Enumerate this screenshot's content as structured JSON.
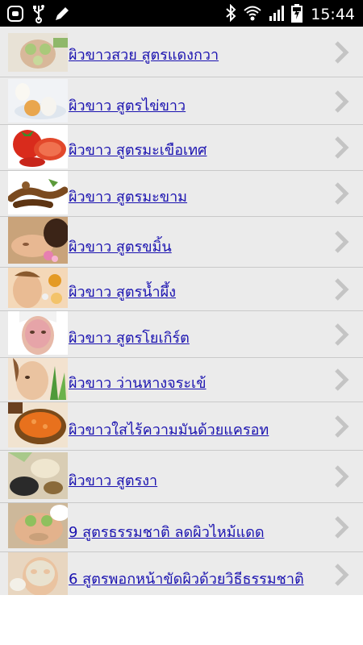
{
  "status_bar": {
    "time": "15:44",
    "left_icons": [
      "app-notification-icon",
      "usb-icon",
      "pencil-icon"
    ],
    "right_icons": [
      "bluetooth-icon",
      "wifi-icon",
      "signal-icon",
      "battery-icon"
    ]
  },
  "list": {
    "items": [
      {
        "label": "ผิวขาวสวย สูตรแดงกวา",
        "thumb": "cucumber-mask-thumbnail"
      },
      {
        "label": "ผิวขาว สูตรไข่ขาว",
        "thumb": "egg-thumbnail"
      },
      {
        "label": "ผิวขาว สูตรมะเขือเทศ",
        "thumb": "tomato-thumbnail"
      },
      {
        "label": "ผิวขาว สูตรมะขาม",
        "thumb": "tamarind-thumbnail"
      },
      {
        "label": "ผิวขาว สูตรขมิ้น",
        "thumb": "spa-face-thumbnail"
      },
      {
        "label": "ผิวขาว สูตรน้ำผึ้ง",
        "thumb": "honey-face-thumbnail"
      },
      {
        "label": "ผิวขาว สูตรโยเกิร์ต",
        "thumb": "yogurt-mask-thumbnail"
      },
      {
        "label": "ผิวขาว ว่านหางจระเข้",
        "thumb": "aloe-face-thumbnail"
      },
      {
        "label": "ผิวขาวใสไร้ความมันด้วยแครอท",
        "thumb": "carrot-thumbnail"
      },
      {
        "label": "ผิวขาว สูตรงา",
        "thumb": "sesame-thumbnail"
      },
      {
        "label": "9 สูตรธรรมชาติ ลดผิวไหม้แดด",
        "thumb": "cucumber-eyes-thumbnail"
      },
      {
        "label": "6 สูตรพอกหน้าขัดผิวด้วยวิธีธรรมชาติ",
        "thumb": "face-mask-thumbnail"
      }
    ]
  },
  "colors": {
    "link": "#1a12b0",
    "row_bg": "#ebebeb",
    "divider": "#c9c9c9",
    "chevron": "#c4c4c4"
  }
}
